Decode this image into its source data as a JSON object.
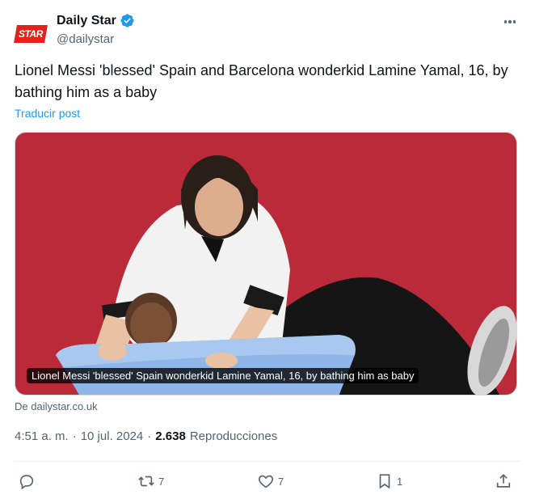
{
  "account": {
    "display_name": "Daily Star",
    "handle": "@dailystar",
    "logo_text": "STAR",
    "verified_color": "#1d9bf0"
  },
  "post": {
    "text": "Lionel Messi 'blessed' Spain and Barcelona wonderkid Lamine Yamal, 16, by bathing him as a baby",
    "translate_label": "Traducir post"
  },
  "card": {
    "caption": "Lionel Messi 'blessed' Spain wonderkid Lamine Yamal, 16, by bathing him as baby",
    "source": "De dailystar.co.uk"
  },
  "meta": {
    "time": "4:51 a. m.",
    "separator": "·",
    "date": "10 jul. 2024",
    "views_count": "2.638",
    "views_label": "Reproducciones"
  },
  "actions": {
    "replies": "",
    "reposts": "7",
    "likes": "7",
    "bookmarks": "1"
  },
  "colors": {
    "accent": "#1d9bf0",
    "secondary_text": "#536471",
    "brand_red": "#e2231a"
  }
}
